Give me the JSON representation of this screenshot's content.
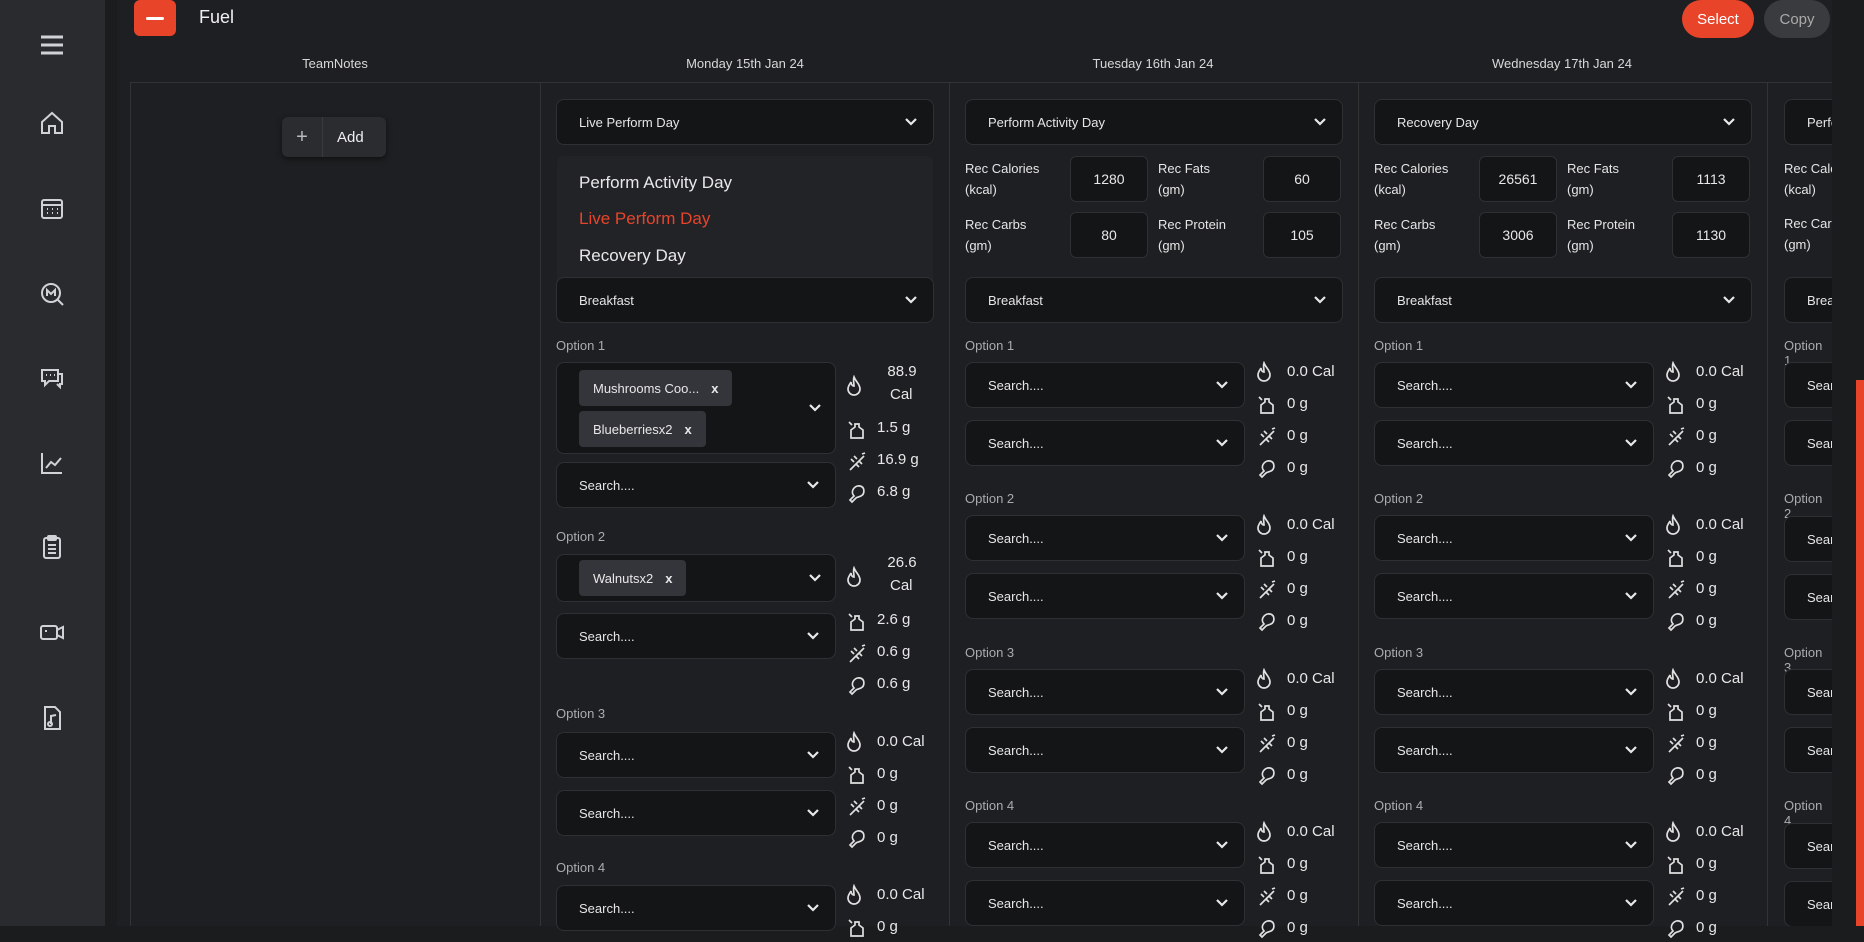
{
  "app": {
    "title": "Fuel",
    "select_label": "Select",
    "copy_label": "Copy"
  },
  "sidebar": {
    "icons": [
      "menu-icon",
      "home-icon",
      "calendar-icon",
      "messages-icon",
      "chat-icon",
      "analytics-icon",
      "clipboard-icon",
      "video-icon",
      "document-icon"
    ]
  },
  "columns": {
    "team_notes": "TeamNotes",
    "monday": "Monday 15th Jan 24",
    "tuesday": "Tuesday 16th Jan 24",
    "wednesday": "Wednesday 17th Jan 24"
  },
  "team_notes": {
    "add_label": "Add"
  },
  "monday": {
    "day_type": "Live Perform Day",
    "menu": [
      "Perform Activity Day",
      "Live Perform Day",
      "Recovery Day"
    ],
    "meal": "Breakfast",
    "options": [
      {
        "label": "Option 1",
        "tags": [
          "Mushrooms Coo...",
          "Blueberriesx2"
        ],
        "search": "Search....",
        "cal": "88.9",
        "cal_unit": "Cal",
        "fat": "1.5 g",
        "carb": "16.9 g",
        "protein": "6.8 g"
      },
      {
        "label": "Option 2",
        "tags": [
          "Walnutsx2"
        ],
        "search": "Search....",
        "cal": "26.6",
        "cal_unit": "Cal",
        "fat": "2.6 g",
        "carb": "0.6 g",
        "protein": "0.6 g"
      },
      {
        "label": "Option 3",
        "search1": "Search....",
        "search2": "Search....",
        "cal": "0.0 Cal",
        "fat": "0 g",
        "carb": "0 g",
        "protein": "0 g"
      },
      {
        "label": "Option 4",
        "search1": "Search....",
        "cal": "0.0 Cal",
        "fat": "0 g"
      }
    ]
  },
  "tuesday": {
    "day_type": "Perform Activity Day",
    "rec": {
      "cal_label": "Rec Calories (kcal)",
      "cal": "1280",
      "fat_label": "Rec Fats (gm)",
      "fat": "60",
      "carb_label": "Rec Carbs (gm)",
      "carb": "80",
      "protein_label": "Rec Protein (gm)",
      "protein": "105"
    },
    "meal": "Breakfast",
    "options": [
      "Option 1",
      "Option 2",
      "Option 3",
      "Option 4"
    ],
    "search": "Search....",
    "cal": "0.0 Cal",
    "g": "0 g"
  },
  "wednesday": {
    "day_type": "Recovery Day",
    "rec": {
      "cal_label": "Rec Calories (kcal)",
      "cal": "26561",
      "fat_label": "Rec Fats (gm)",
      "fat": "1113",
      "carb_label": "Rec Carbs (gm)",
      "carb": "3006",
      "protein_label": "Rec Protein (gm)",
      "protein": "1130"
    },
    "meal": "Breakfast",
    "options": [
      "Option 1",
      "Option 2",
      "Option 3",
      "Option 4"
    ],
    "search": "Search....",
    "cal": "0.0 Cal",
    "g": "0 g"
  },
  "partial": {
    "day_type": "Perfo",
    "cal_label": "Rec Calo (kcal)",
    "carb_label": "Rec Carb (gm)",
    "meal": "Brea",
    "options": [
      "Option 1",
      "Option 2",
      "Option 3",
      "Option 4"
    ],
    "search": "Sear"
  }
}
